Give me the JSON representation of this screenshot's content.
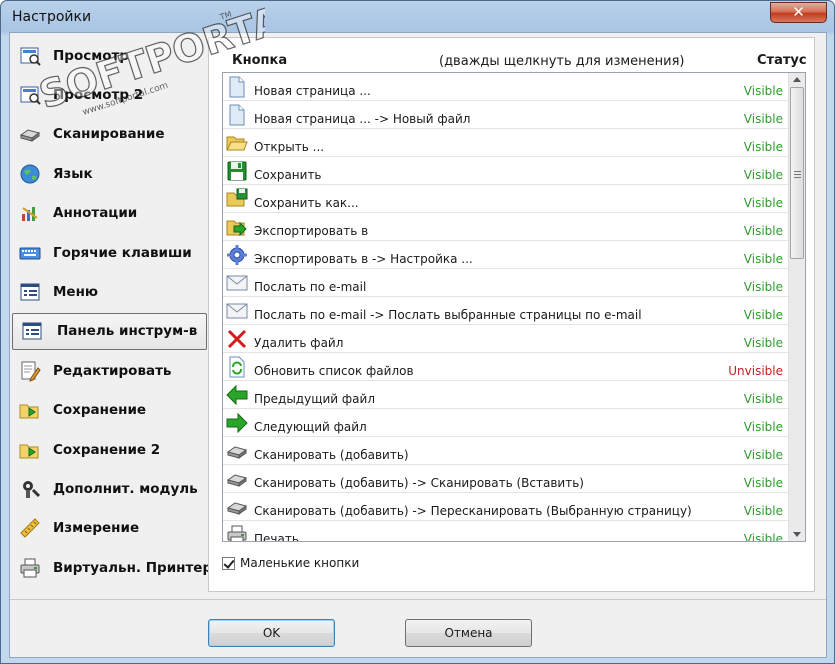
{
  "window": {
    "title": "Настройки",
    "close_glyph": "✕"
  },
  "watermark": {
    "brand": "SOFTPORTAL",
    "tm": "TM",
    "url": "www.softportal.com"
  },
  "nav": {
    "items": [
      {
        "label": "Просмотр",
        "icon": "view-icon"
      },
      {
        "label": "Просмотр 2",
        "icon": "view2-icon"
      },
      {
        "label": "Сканирование",
        "icon": "scanner-icon"
      },
      {
        "label": "Язык",
        "icon": "globe-icon"
      },
      {
        "label": "Аннотации",
        "icon": "annotation-icon"
      },
      {
        "label": "Горячие клавиши",
        "icon": "keyboard-icon"
      },
      {
        "label": "Меню",
        "icon": "menu-icon"
      },
      {
        "label": "Панель инструм-в",
        "icon": "toolbar-icon",
        "selected": true
      },
      {
        "label": "Редактировать",
        "icon": "edit-icon"
      },
      {
        "label": "Сохранение",
        "icon": "save-folder-icon"
      },
      {
        "label": "Сохранение 2",
        "icon": "save-folder2-icon"
      },
      {
        "label": "Дополнит. модуль",
        "icon": "plugin-icon"
      },
      {
        "label": "Измерение",
        "icon": "ruler-icon"
      },
      {
        "label": "Виртуальн. Принтер",
        "icon": "printer-icon"
      }
    ]
  },
  "table": {
    "col_button": "Кнопка",
    "col_hint": "(дважды щелкнуть для изменения)",
    "col_status": "Статус",
    "rows": [
      {
        "name": "Новая страница ...",
        "status": "Visible",
        "icon": "new-page-icon"
      },
      {
        "name": "Новая страница ... -> Новый файл",
        "status": "Visible",
        "icon": "new-page-icon"
      },
      {
        "name": "Открыть ...",
        "status": "Visible",
        "icon": "open-folder-icon"
      },
      {
        "name": "Сохранить",
        "status": "Visible",
        "icon": "floppy-icon"
      },
      {
        "name": "Сохранить как...",
        "status": "Visible",
        "icon": "save-as-icon"
      },
      {
        "name": "Экспортировать в",
        "status": "Visible",
        "icon": "export-icon"
      },
      {
        "name": "Экспортировать в -> Настройка ...",
        "status": "Visible",
        "icon": "gear-icon"
      },
      {
        "name": "Послать по e-mail",
        "status": "Visible",
        "icon": "mail-icon"
      },
      {
        "name": "Послать по e-mail -> Послать выбранные страницы по e-mail",
        "status": "Visible",
        "icon": "mail-icon"
      },
      {
        "name": "Удалить файл",
        "status": "Visible",
        "icon": "delete-icon"
      },
      {
        "name": "Обновить список файлов",
        "status": "Unvisible",
        "icon": "refresh-icon"
      },
      {
        "name": "Предыдущий файл",
        "status": "Visible",
        "icon": "arrow-left-icon"
      },
      {
        "name": "Следующий файл",
        "status": "Visible",
        "icon": "arrow-right-icon"
      },
      {
        "name": "Сканировать (добавить)",
        "status": "Visible",
        "icon": "scanner-icon"
      },
      {
        "name": "Сканировать (добавить) -> Сканировать (Вставить)",
        "status": "Visible",
        "icon": "scanner-icon"
      },
      {
        "name": "Сканировать (добавить) -> Пересканировать (Выбранную страницу)",
        "status": "Visible",
        "icon": "scanner-icon"
      },
      {
        "name": "Печать",
        "status": "Visible",
        "icon": "printer-icon"
      }
    ]
  },
  "options": {
    "small_buttons_label": "Маленькие кнопки",
    "small_buttons_checked": true
  },
  "buttons": {
    "ok": "OK",
    "cancel": "Отмена"
  },
  "colors": {
    "visible": "#2f9b2f",
    "unvisible": "#c62020"
  }
}
